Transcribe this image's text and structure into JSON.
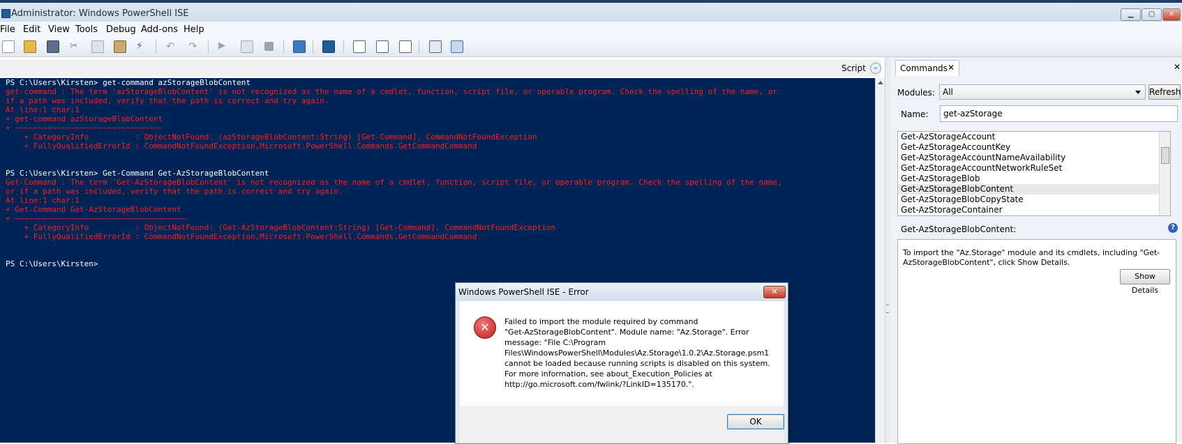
{
  "window": {
    "title": "Administrator: Windows PowerShell ISE",
    "minimize_glyph": "▁",
    "maximize_glyph": "▢",
    "close_glyph": "✕"
  },
  "menu": [
    "File",
    "Edit",
    "View",
    "Tools",
    "Debug",
    "Add-ons",
    "Help"
  ],
  "toolbar": {
    "icons": [
      "new-icon",
      "open-icon",
      "save-icon",
      "cut-icon",
      "copy-icon",
      "paste-icon",
      "clear-icon",
      "undo-icon",
      "redo-icon",
      "run-icon",
      "run-selection-icon",
      "stop-icon",
      "remote-icon",
      "powershell-icon",
      "layout-top-icon",
      "layout-right-icon",
      "layout-max-icon",
      "show-commands-icon",
      "show-script-icon"
    ]
  },
  "script_pane": {
    "label": "Script",
    "chevron": "⌄"
  },
  "console": {
    "lines": [
      {
        "c": "w",
        "t": "PS C:\\Users\\Kirsten> get-command azStorageBlobContent"
      },
      {
        "c": "r",
        "t": "get-command : The term 'azStorageBlobContent' is not recognized as the name of a cmdlet, function, script file, or operable program. Check the spelling of the name, or"
      },
      {
        "c": "r",
        "t": "if a path was included, verify that the path is correct and try again."
      },
      {
        "c": "r",
        "t": "At line:1 char:1"
      },
      {
        "c": "r",
        "t": "+ get-command azStorageBlobContent"
      },
      {
        "c": "r",
        "t": "+ ~~~~~~~~~~~~~~~~~~~~~~~~~~~~~~~~"
      },
      {
        "c": "r",
        "t": "    + CategoryInfo          : ObjectNotFound: (azStorageBlobContent:String) [Get-Command], CommandNotFoundException"
      },
      {
        "c": "r",
        "t": "    + FullyQualifiedErrorId : CommandNotFoundException,Microsoft.PowerShell.Commands.GetCommandCommand"
      },
      {
        "c": "w",
        "t": " "
      },
      {
        "c": "w",
        "t": " "
      },
      {
        "c": "w",
        "t": "PS C:\\Users\\Kirsten> Get-Command Get-AzStorageBlobContent"
      },
      {
        "c": "r",
        "t": "Get-Command : The term 'Get-AzStorageBlobContent' is not recognized as the name of a cmdlet, function, script file, or operable program. Check the spelling of the name,"
      },
      {
        "c": "r",
        "t": "or if a path was included, verify that the path is correct and try again."
      },
      {
        "c": "r",
        "t": "At line:1 char:1"
      },
      {
        "c": "r",
        "t": "+ Get-Command Get-AzStorageBlobContent"
      },
      {
        "c": "r",
        "t": "+ ~~~~~~~~~~~~~~~~~~~~~~~~~~~~~~~~~~~~~"
      },
      {
        "c": "r",
        "t": "    + CategoryInfo          : ObjectNotFound: (Get-AzStorageBlobContent:String) [Get-Command], CommandNotFoundException"
      },
      {
        "c": "r",
        "t": "    + FullyQualifiedErrorId : CommandNotFoundException,Microsoft.PowerShell.Commands.GetCommandCommand"
      },
      {
        "c": "w",
        "t": " "
      },
      {
        "c": "w",
        "t": " "
      },
      {
        "c": "w",
        "t": "PS C:\\Users\\Kirsten>"
      }
    ]
  },
  "commands": {
    "tab_label": "Commands",
    "tab_close": "✕",
    "pane_close": "✕",
    "modules_label": "Modules:",
    "modules_value": "All",
    "refresh_label": "Refresh",
    "name_label": "Name:",
    "name_value": "get-azStorage",
    "items": [
      "Get-AzStorageAccount",
      "Get-AzStorageAccountKey",
      "Get-AzStorageAccountNameAvailability",
      "Get-AzStorageAccountNetworkRuleSet",
      "Get-AzStorageBlob",
      "Get-AzStorageBlobContent",
      "Get-AzStorageBlobCopyState",
      "Get-AzStorageContainer"
    ],
    "selected_index": 5,
    "selected_title": "Get-AzStorageBlobContent:",
    "help_glyph": "?",
    "help_text_1": "To import the \"Az.Storage\" module and its cmdlets, including \"Get-",
    "help_text_2": "AzStorageBlobContent\", click Show Details.",
    "show_details_label": "Show Details"
  },
  "dialog": {
    "title": "Windows PowerShell ISE - Error",
    "close_glyph": "✕",
    "error_glyph": "✕",
    "message_lines": [
      "Failed to import the module required by command",
      "\"Get-AzStorageBlobContent\". Module name: \"Az.Storage\". Error",
      "message: \"File C:\\Program",
      "Files\\WindowsPowerShell\\Modules\\Az.Storage\\1.0.2\\Az.Storage.psm1",
      "cannot be loaded because running scripts is disabled on this system.",
      "For more information, see about_Execution_Policies at",
      "http://go.microsoft.com/fwlink/?LinkID=135170.\"."
    ],
    "ok_label": "OK"
  },
  "colors": {
    "console_bg": "#012456",
    "console_text": "#ffffff",
    "error_text": "#ff1e1e",
    "error_icon": "#d9262b"
  }
}
